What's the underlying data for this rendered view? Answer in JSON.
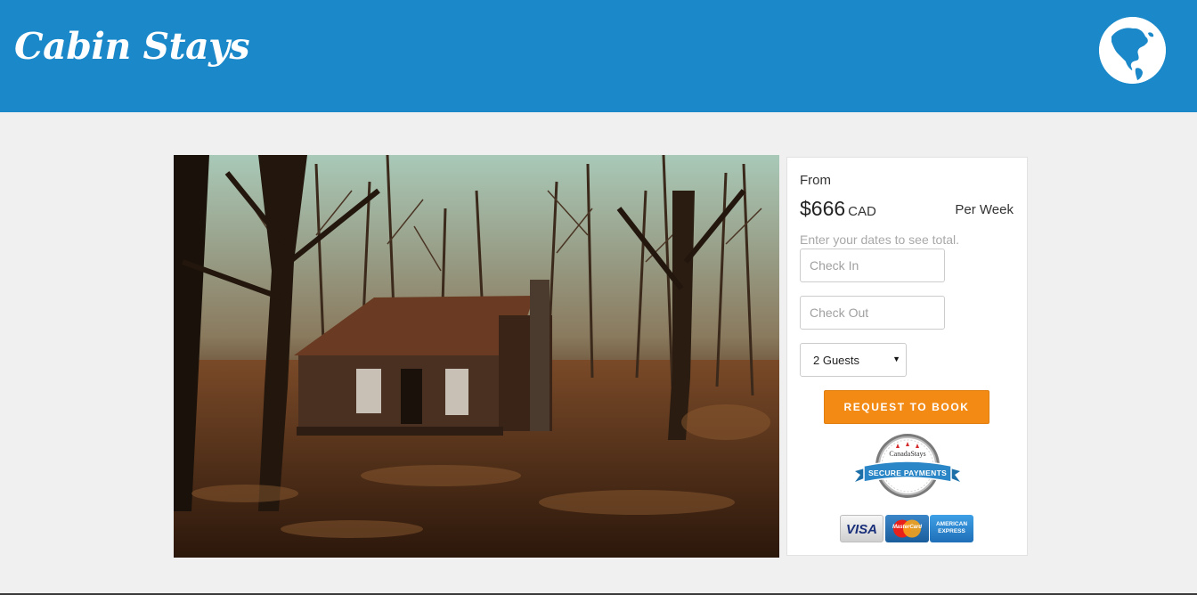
{
  "header": {
    "brand": "Cabin Stays",
    "globe_icon": "globe-americas-icon",
    "colors": {
      "bar": "#1a88c9",
      "logo": "#ffffff"
    }
  },
  "gallery": {
    "image_icon": "cabin-photo"
  },
  "booking": {
    "from_label": "From",
    "price": "$666",
    "currency": "CAD",
    "period": "Per Week",
    "hint": "Enter your dates to see total.",
    "check_in_placeholder": "Check In",
    "check_out_placeholder": "Check Out",
    "guests_selected": "2 Guests",
    "request_button": "REQUEST TO BOOK",
    "button_color": "#f28a14"
  },
  "trust": {
    "badge_brand": "CanadaStays",
    "badge_ribbon": "SECURE PAYMENTS",
    "payment_cards": [
      {
        "name": "VISA",
        "icon": "visa-card-icon"
      },
      {
        "name": "MasterCard",
        "icon": "mastercard-icon"
      },
      {
        "name": "AMERICAN EXPRESS",
        "icon": "amex-card-icon"
      }
    ]
  }
}
